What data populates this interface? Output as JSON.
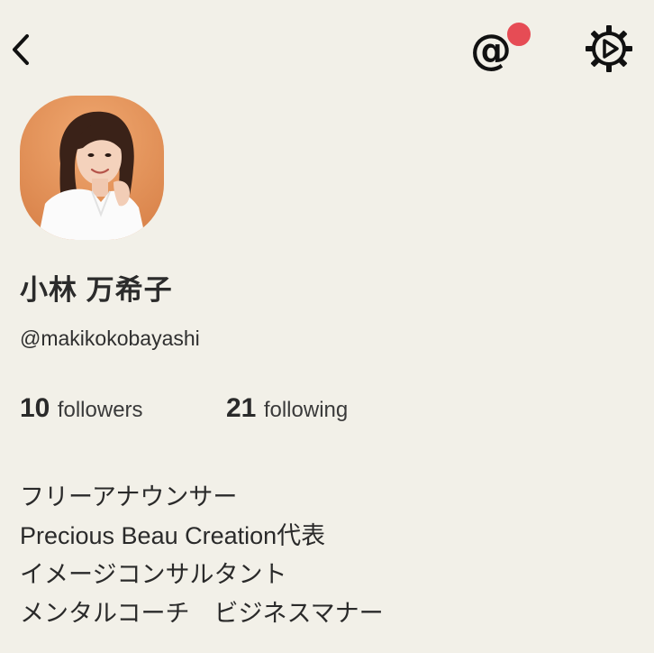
{
  "header": {
    "back_icon": "chevron-left-icon",
    "mention_icon": "at-sign-icon",
    "mention_glyph": "@",
    "notification_color": "#e64c55",
    "settings_icon": "gear-icon"
  },
  "profile": {
    "avatar_icon": "profile-photo",
    "name": "小林 万希子",
    "handle": "@makikokobayashi",
    "followers_count": "10",
    "followers_label": "followers",
    "following_count": "21",
    "following_label": "following",
    "bio": [
      "フリーアナウンサー",
      "Precious Beau Creation代表",
      "イメージコンサルタント",
      "メンタルコーチ　ビジネスマナー"
    ]
  },
  "colors": {
    "background": "#f2f0e8",
    "text": "#2a2a2a"
  }
}
